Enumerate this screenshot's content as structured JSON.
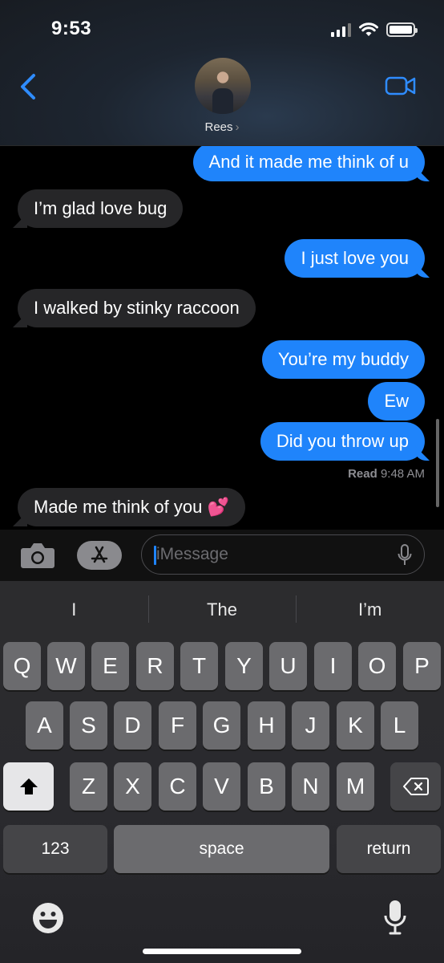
{
  "status": {
    "time": "9:53"
  },
  "header": {
    "contact_name": "Rees",
    "contact_chevron": "›"
  },
  "messages": [
    {
      "text": "And it made me think of u",
      "from": "me"
    },
    {
      "text": "I’m glad love bug",
      "from": "them"
    },
    {
      "text": "I just love you",
      "from": "me"
    },
    {
      "text": "I walked by stinky raccoon",
      "from": "them"
    },
    {
      "text": "You’re my buddy",
      "from": "me"
    },
    {
      "text": "Ew",
      "from": "me"
    },
    {
      "text": "Did you throw up",
      "from": "me"
    },
    {
      "text": "Made me think of you 💕",
      "from": "them"
    }
  ],
  "read_receipt": {
    "label": "Read",
    "time": "9:48 AM"
  },
  "input": {
    "placeholder": "iMessage"
  },
  "suggestions": [
    "I",
    "The",
    "I’m"
  ],
  "keyboard": {
    "row1": [
      "Q",
      "W",
      "E",
      "R",
      "T",
      "Y",
      "U",
      "I",
      "O",
      "P"
    ],
    "row2": [
      "A",
      "S",
      "D",
      "F",
      "G",
      "H",
      "J",
      "K",
      "L"
    ],
    "row3": [
      "Z",
      "X",
      "C",
      "V",
      "B",
      "N",
      "M"
    ],
    "numbers_label": "123",
    "space_label": "space",
    "return_label": "return"
  },
  "colors": {
    "sent_bubble": "#1f84fb",
    "received_bubble": "#262628",
    "accent": "#2f8cff"
  },
  "icons": [
    "back-chevron-icon",
    "video-camera-icon",
    "camera-icon",
    "app-store-icon",
    "microphone-icon",
    "shift-icon",
    "delete-icon",
    "emoji-icon",
    "dictation-icon"
  ]
}
